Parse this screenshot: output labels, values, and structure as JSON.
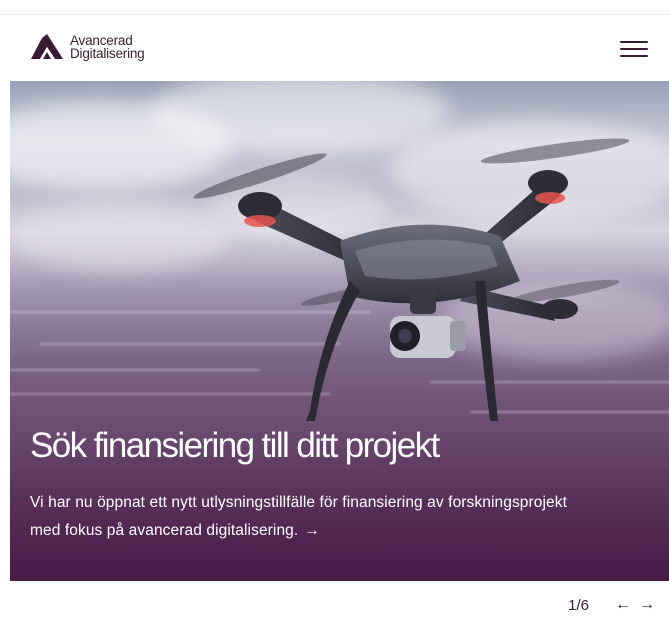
{
  "header": {
    "logo_line1": "Avancerad",
    "logo_line2": "Digitalisering",
    "menu_icon": "hamburger-menu-icon"
  },
  "hero": {
    "title": "Sök finansiering till ditt projekt",
    "text": "Vi har nu öppnat ett nytt utlysningstillfälle för finansiering av forskningsprojekt med fokus på avancerad digitalisering.",
    "link_arrow": "→",
    "image_subject": "drone-in-flight"
  },
  "pager": {
    "current": "1/6",
    "prev_arrow": "←",
    "next_arrow": "→"
  },
  "colors": {
    "brand": "#3a1b33",
    "overlay": "#5e355f",
    "text_light": "#ffffff"
  }
}
